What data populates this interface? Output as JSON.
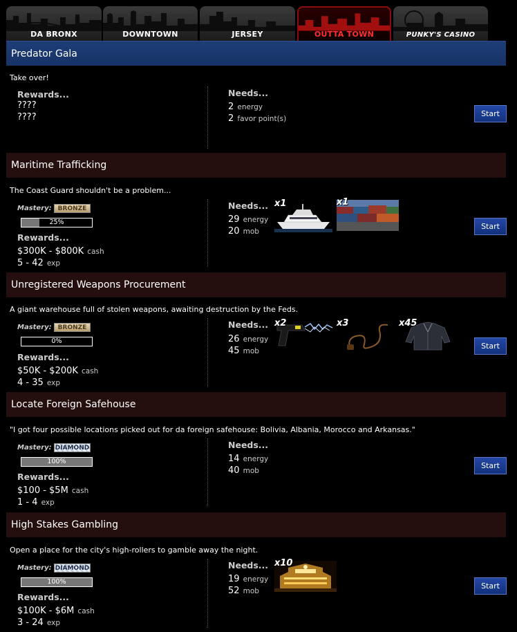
{
  "tabs": [
    {
      "label": "DA BRONX",
      "active": false
    },
    {
      "label": "DOWNTOWN",
      "active": false
    },
    {
      "label": "JERSEY",
      "active": false
    },
    {
      "label": "OUTTA TOWN",
      "active": true
    },
    {
      "label": "PUNKY'S CASINO",
      "active": false
    }
  ],
  "jobs": [
    {
      "title": "Predator Gala",
      "description": "Take over!",
      "rewards_label": "Rewards...",
      "reward_1": "????",
      "reward_2": "????",
      "needs_label": "Needs...",
      "need_1_value": "2",
      "need_1_unit": "energy",
      "need_2_value": "2",
      "need_2_unit": "favor point(s)",
      "start_label": "Start"
    },
    {
      "title": "Maritime Trafficking",
      "description": "The Coast Guard shouldn't be a problem...",
      "mastery_label": "Mastery:",
      "mastery_tier": "BRONZE",
      "progress_text": "25%",
      "progress_value": 0.25,
      "rewards_label": "Rewards...",
      "cash_value": "$300K - $800K",
      "cash_unit": "cash",
      "exp_value": "5 - 42",
      "exp_unit": "exp",
      "needs_label": "Needs...",
      "need_1_value": "29",
      "need_1_unit": "energy",
      "need_2_value": "20",
      "need_2_unit": "mob",
      "items": [
        {
          "qty": "x1",
          "icon": "yacht-icon"
        },
        {
          "qty": "x1",
          "icon": "shipping-containers-icon"
        }
      ],
      "start_label": "Start"
    },
    {
      "title": "Unregistered Weapons Procurement",
      "description": "A giant warehouse full of stolen weapons, awaiting destruction by the Feds.",
      "mastery_label": "Mastery:",
      "mastery_tier": "BRONZE",
      "progress_text": "0%",
      "progress_value": 0,
      "rewards_label": "Rewards...",
      "cash_value": "$50K - $200K",
      "cash_unit": "cash",
      "exp_value": "4 - 35",
      "exp_unit": "exp",
      "needs_label": "Needs...",
      "need_1_value": "26",
      "need_1_unit": "energy",
      "need_2_value": "45",
      "need_2_unit": "mob",
      "items": [
        {
          "qty": "x2",
          "icon": "taser-icon"
        },
        {
          "qty": "x3",
          "icon": "whip-icon"
        },
        {
          "qty": "x45",
          "icon": "jacket-icon"
        }
      ],
      "start_label": "Start"
    },
    {
      "title": "Locate Foreign Safehouse",
      "description": "\"I got four possible locations picked out for da foreign safehouse: Bolivia, Albania, Morocco and Arkansas.\"",
      "mastery_label": "Mastery:",
      "mastery_tier": "DIAMOND",
      "progress_text": "100%",
      "progress_value": 1,
      "rewards_label": "Rewards...",
      "cash_value": "$100 - $5M",
      "cash_unit": "cash",
      "exp_value": "1 - 4",
      "exp_unit": "exp",
      "needs_label": "Needs...",
      "need_1_value": "14",
      "need_1_unit": "energy",
      "need_2_value": "40",
      "need_2_unit": "mob",
      "start_label": "Start"
    },
    {
      "title": "High Stakes Gambling",
      "description": "Open a place for the city's high-rollers to gamble away the night.",
      "mastery_label": "Mastery:",
      "mastery_tier": "DIAMOND",
      "progress_text": "100%",
      "progress_value": 1,
      "rewards_label": "Rewards...",
      "cash_value": "$100K - $6M",
      "cash_unit": "cash",
      "exp_value": "3 - 24",
      "exp_unit": "exp",
      "needs_label": "Needs...",
      "need_1_value": "19",
      "need_1_unit": "energy",
      "need_2_value": "52",
      "need_2_unit": "mob",
      "items": [
        {
          "qty": "x10",
          "icon": "casino-icon"
        }
      ],
      "start_label": "Start"
    }
  ],
  "colors": {
    "reward_green": "#22e322",
    "header_featured": "#1e3d77",
    "header_normal": "#250e0e",
    "active_tab": "#ff3030"
  }
}
